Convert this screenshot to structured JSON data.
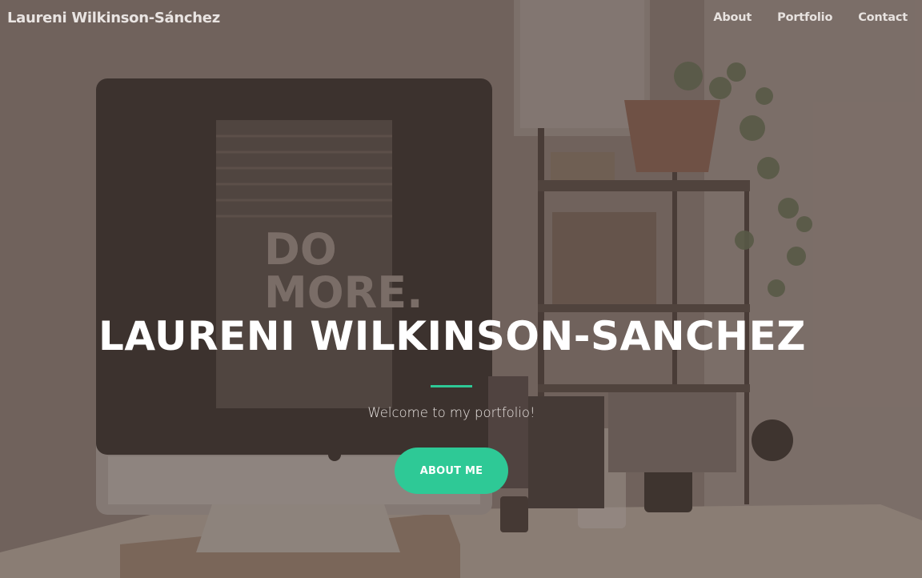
{
  "navbar": {
    "brand": "Laureni Wilkinson-Sánchez",
    "links": [
      {
        "label": "About"
      },
      {
        "label": "Portfolio"
      },
      {
        "label": "Contact"
      }
    ]
  },
  "hero": {
    "title": "LAURENI WILKINSON-SANCHEZ",
    "subtitle": "Welcome to my portfolio!",
    "cta_label": "ABOUT ME",
    "background_screen_text": [
      "DO",
      "MORE."
    ]
  },
  "colors": {
    "accent": "#2ec996",
    "text_light": "#ffffff",
    "overlay": "#5c4a42"
  }
}
